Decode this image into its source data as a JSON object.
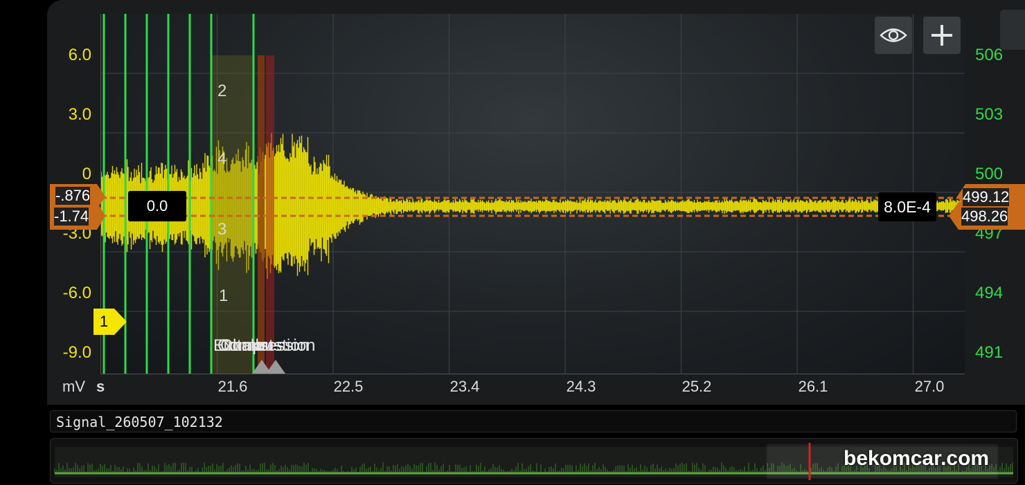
{
  "left_axis": {
    "unit": "mV",
    "ticks": [
      "6.0",
      "3.0",
      "0",
      "-3.0",
      "-6.0",
      "-9.0"
    ]
  },
  "right_axis": {
    "ticks": [
      "506",
      "503",
      "500",
      "497",
      "494",
      "491"
    ]
  },
  "x_axis": {
    "unit": "s",
    "ticks": [
      "21.6",
      "22.5",
      "23.4",
      "24.3",
      "25.2",
      "26.1",
      "27.0"
    ]
  },
  "cursors": {
    "left_upper": "-.876",
    "left_lower": "-1.74",
    "delta_box": "0.0",
    "right_upper": "499.12",
    "right_lower": "498.26",
    "right_box": "8.0E-4"
  },
  "cylinder_numbers": [
    "2",
    "4",
    "3",
    "1"
  ],
  "marker": "1",
  "overlapping_labels": [
    "Exhaust",
    "Compression",
    "Intake",
    "Combustion"
  ],
  "signal_name": "Signal_260507_102132",
  "watermark": "bekomcar.com",
  "colors": {
    "signal": "#f2e600",
    "cursor": "#c96a1a",
    "markers": "#2fd94a"
  },
  "icons": {
    "view": "eye-icon",
    "add": "plus-icon"
  }
}
